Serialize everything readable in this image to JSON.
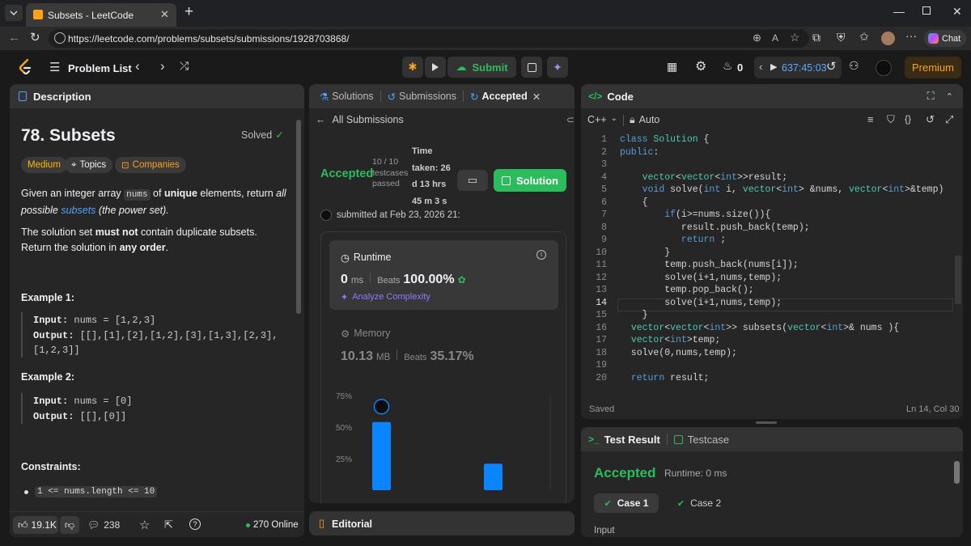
{
  "browser": {
    "tab_title": "Subsets - LeetCode",
    "url": "https://leetcode.com/problems/subsets/submissions/1928703868/",
    "chat_label": "Chat"
  },
  "app_header": {
    "problem_list": "Problem List",
    "submit": "Submit",
    "streak": "0",
    "timer": "637:45:03",
    "premium": "Premium"
  },
  "description": {
    "tab_label": "Description",
    "title": "78. Subsets",
    "solved": "Solved",
    "difficulty": "Medium",
    "topics": "Topics",
    "companies": "Companies",
    "para1_a": "Given an integer array ",
    "para1_code": "nums",
    "para1_b": " of ",
    "para1_bold": "unique",
    "para1_c": " elements, return ",
    "para1_it1": "all possible ",
    "para1_link": "subsets",
    "para1_it2": " (the power set).",
    "para2_a": "The solution set ",
    "para2_bold1": "must not",
    "para2_b": " contain duplicate subsets. Return the solution in ",
    "para2_bold2": "any order",
    "para2_c": ".",
    "example1_title": "Example 1:",
    "example1_input_label": "Input:",
    "example1_input": " nums = [1,2,3]",
    "example1_output_label": "Output:",
    "example1_output_l1": " [[],[1],[2],[1,2],[3],[1,3],[2,3],",
    "example1_output_l2": "[1,2,3]]",
    "example2_title": "Example 2:",
    "example2_input_label": "Input:",
    "example2_input": " nums = [0]",
    "example2_output_label": "Output:",
    "example2_output": " [[],[0]]",
    "constraints_title": "Constraints:",
    "constraint1": "1 <= nums.length <= 10",
    "likes": "19.1K",
    "comments": "238",
    "online": "270 Online"
  },
  "submission": {
    "tab_solutions": "Solutions",
    "tab_submissions": "Submissions",
    "tab_accepted": "Accepted",
    "back_label": "All Submissions",
    "status": "Accepted",
    "testcases_l1": "10 / 10",
    "testcases_l2": "testcases",
    "testcases_l3": "passed",
    "time_l1": "Time",
    "time_l2": "taken: 26",
    "time_l3": "d 13 hrs",
    "time_l4": "45 m 3 s",
    "solution_button": "Solution",
    "submitted_at": "submitted at Feb 23, 2026 21:",
    "runtime_title": "Runtime",
    "runtime_value": "0",
    "runtime_unit": "ms",
    "runtime_beats_label": "Beats",
    "runtime_beats": "100.00%",
    "analyze": "Analyze Complexity",
    "memory_title": "Memory",
    "memory_value": "10.13",
    "memory_unit": "MB",
    "memory_beats_label": "Beats",
    "memory_beats": "35.17%",
    "editorial": "Editorial"
  },
  "chart_data": {
    "type": "bar",
    "y_ticks": [
      "75%",
      "50%",
      "25%"
    ],
    "ylim": [
      0,
      75
    ],
    "values": [
      54,
      21
    ],
    "bar_color": "#0a84ff"
  },
  "code_panel": {
    "tab_label": "Code",
    "language": "C++",
    "mode": "Auto",
    "saved": "Saved",
    "cursor": "Ln 14, Col 30",
    "lines": [
      {
        "n": "1",
        "t": "class Solution {"
      },
      {
        "n": "2",
        "t": "public:"
      },
      {
        "n": "3",
        "t": ""
      },
      {
        "n": "4",
        "t": "    vector<vector<int>>result;"
      },
      {
        "n": "5",
        "t": "    void solve(int i, vector<int> &nums, vector<int>&temp)"
      },
      {
        "n": "6",
        "t": "    {"
      },
      {
        "n": "7",
        "t": "        if(i>=nums.size()){"
      },
      {
        "n": "8",
        "t": "           result.push_back(temp);"
      },
      {
        "n": "9",
        "t": "           return ;"
      },
      {
        "n": "10",
        "t": "        }"
      },
      {
        "n": "11",
        "t": "        temp.push_back(nums[i]);"
      },
      {
        "n": "12",
        "t": "        solve(i+1,nums,temp);"
      },
      {
        "n": "13",
        "t": "        temp.pop_back();"
      },
      {
        "n": "14",
        "t": "        solve(i+1,nums,temp);"
      },
      {
        "n": "15",
        "t": "    }"
      },
      {
        "n": "16",
        "t": "  vector<vector<int>> subsets(vector<int>& nums ){"
      },
      {
        "n": "17",
        "t": "  vector<int>temp;"
      },
      {
        "n": "18",
        "t": "  solve(0,nums,temp);"
      },
      {
        "n": "19",
        "t": ""
      },
      {
        "n": "20",
        "t": "  return result;"
      }
    ]
  },
  "test_result": {
    "tab_result": "Test Result",
    "tab_testcase": "Testcase",
    "status": "Accepted",
    "runtime": "Runtime: 0 ms",
    "case1": "Case 1",
    "case2": "Case 2",
    "input_label": "Input"
  },
  "colors": {
    "accent_green": "#2cbb5d",
    "orange": "#ffa116",
    "blue": "#0a84ff",
    "medium": "#ffb800"
  }
}
